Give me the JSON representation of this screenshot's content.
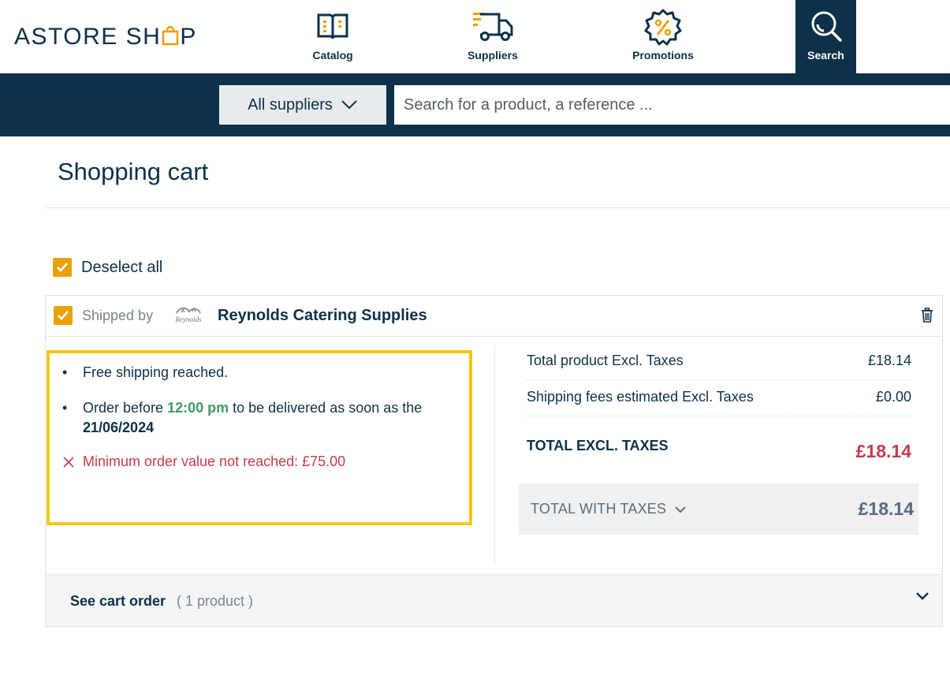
{
  "brand": {
    "logo_text_before": "ASTORE SH",
    "logo_text_after": "P",
    "accent": "#e9a10b",
    "navy": "#0d3149"
  },
  "nav": {
    "catalog": {
      "label": "Catalog",
      "icon": "catalog-book-icon"
    },
    "suppliers": {
      "label": "Suppliers",
      "icon": "delivery-truck-icon"
    },
    "promotions": {
      "label": "Promotions",
      "icon": "percent-badge-icon"
    },
    "search": {
      "label": "Search",
      "icon": "search-icon"
    }
  },
  "searchbar": {
    "supplier_select_value": "All suppliers",
    "search_placeholder": "Search for a product, a reference ..."
  },
  "page": {
    "title": "Shopping cart"
  },
  "cart": {
    "deselect_all_label": "Deselect all",
    "supplier": {
      "shipped_by_label": "Shipped by",
      "logo_text": "Reynolds",
      "name": "Reynolds Catering Supplies"
    },
    "info": {
      "free_shipping": "Free shipping reached.",
      "order_before_prefix": "Order before ",
      "order_time": "12:00 pm",
      "order_before_suffix": " to be delivered as soon as the ",
      "delivery_date": "21/06/2024",
      "min_order_warning": "Minimum order value not reached: £75.00"
    },
    "totals": {
      "product_excl_label": "Total product Excl. Taxes",
      "product_excl_value": "£18.14",
      "shipping_label": "Shipping fees estimated Excl. Taxes",
      "shipping_value": "£0.00",
      "total_excl_label": "TOTAL EXCL. TAXES",
      "total_excl_value": "£18.14",
      "total_with_taxes_label": "TOTAL WITH TAXES",
      "total_with_taxes_value": "£18.14"
    },
    "footer": {
      "see_order_label": "See cart order",
      "product_count": "( 1 product )"
    }
  }
}
